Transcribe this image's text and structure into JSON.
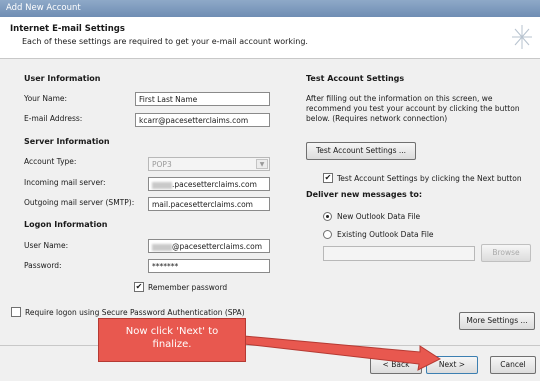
{
  "window": {
    "title": "Add New Account"
  },
  "header": {
    "title": "Internet E-mail Settings",
    "subtitle": "Each of these settings are required to get your e-mail account working."
  },
  "user_info": {
    "heading": "User Information",
    "name_label": "Your Name:",
    "name_value": "First Last Name",
    "email_label": "E-mail Address:",
    "email_value": "kcarr@pacesetterclaims.com"
  },
  "server_info": {
    "heading": "Server Information",
    "account_type_label": "Account Type:",
    "account_type_value": "POP3",
    "incoming_label": "Incoming mail server:",
    "incoming_value": ".pacesetterclaims.com",
    "outgoing_label": "Outgoing mail server (SMTP):",
    "outgoing_value": "mail.pacesetterclaims.com"
  },
  "logon_info": {
    "heading": "Logon Information",
    "username_label": "User Name:",
    "username_value": "@pacesetterclaims.com",
    "password_label": "Password:",
    "password_value": "*******",
    "remember_label": "Remember password",
    "remember_checked": "✔",
    "spa_label": "Require logon using Secure Password Authentication (SPA)"
  },
  "test_settings": {
    "heading": "Test Account Settings",
    "description_1": "After filling out the information on this screen, we",
    "description_2": "recommend you test your account by clicking the button",
    "description_3": "below. (Requires network connection)",
    "test_button": "Test Account Settings ...",
    "auto_test_label": "Test Account Settings by clicking the Next button",
    "auto_test_checked": "✔"
  },
  "deliver": {
    "heading": "Deliver new messages to:",
    "option_new": "New Outlook Data File",
    "option_existing": "Existing Outlook Data File",
    "browse_button": "Browse"
  },
  "buttons": {
    "more_settings": "More Settings ...",
    "back": "< Back",
    "next": "Next >",
    "cancel": "Cancel"
  },
  "annotation": {
    "callout_line1": "Now click 'Next' to",
    "callout_line2": "finalize.",
    "color": "#e8584f"
  }
}
